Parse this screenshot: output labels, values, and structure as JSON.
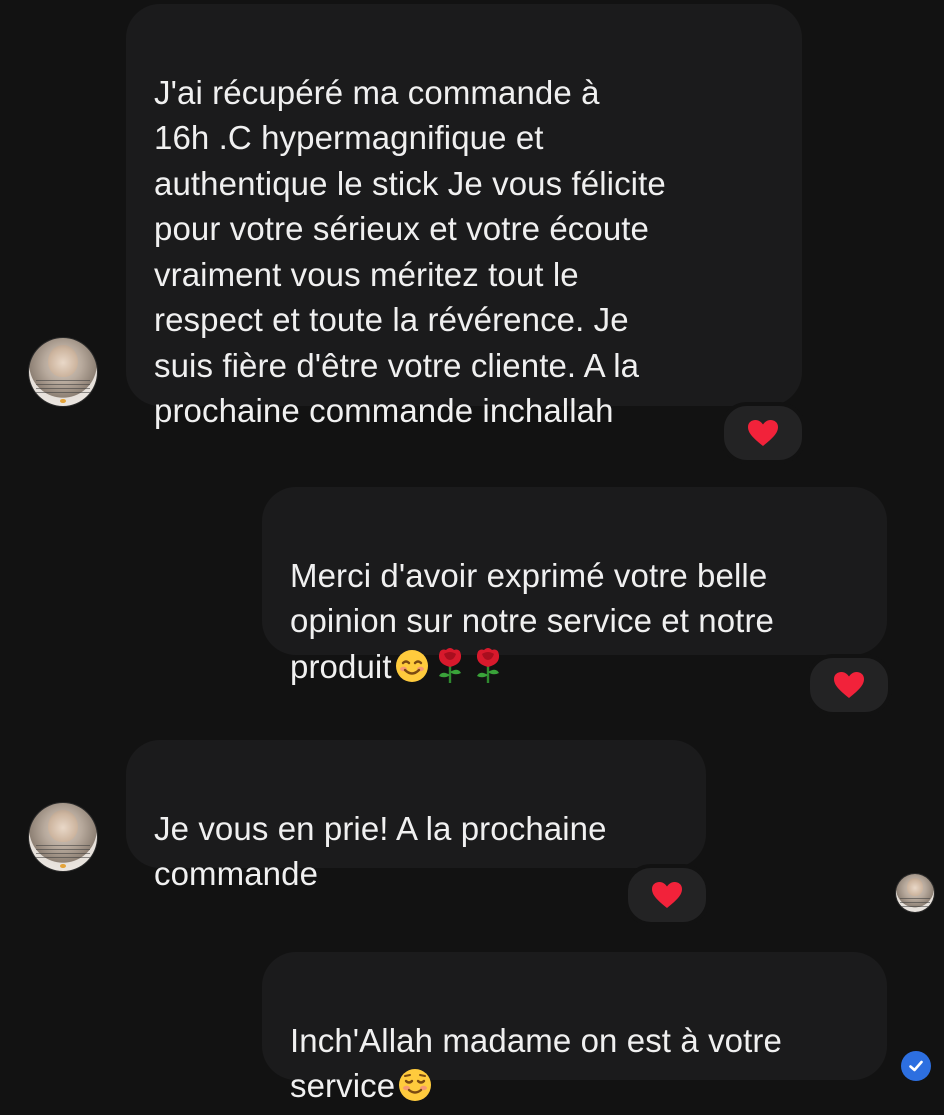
{
  "conversation": {
    "messages": [
      {
        "sender": "customer",
        "text": "J'ai récupéré ma commande à\n16h .C hypermagnifique et\nauthentique le stick Je vous félicite\npour votre sérieux et votre écoute\nvraiment vous méritez tout le\nrespect et toute la révérence. Je\nsuis fière d'être votre cliente. A la\nprochaine commande inchallah",
        "reaction": "heart"
      },
      {
        "sender": "shop",
        "text": "Merci d'avoir exprimé votre belle\nopinion sur notre service et notre\nproduit",
        "emojis": [
          "smiling-face-icon",
          "rose-icon",
          "rose-icon"
        ],
        "reaction": "heart"
      },
      {
        "sender": "customer",
        "text": "Je vous en prie! A la prochaine\ncommande",
        "reaction": "heart"
      },
      {
        "sender": "shop",
        "text": "Inch'Allah madame on est à votre\nservice",
        "emojis": [
          "relieved-smiling-face-icon"
        ],
        "status": "seen"
      }
    ]
  },
  "colors": {
    "background": "#121212",
    "bubble": "#1b1b1c",
    "text": "#f0f0f0",
    "heart": "#f2223a",
    "seen_indicator": "#2d6fe0"
  }
}
